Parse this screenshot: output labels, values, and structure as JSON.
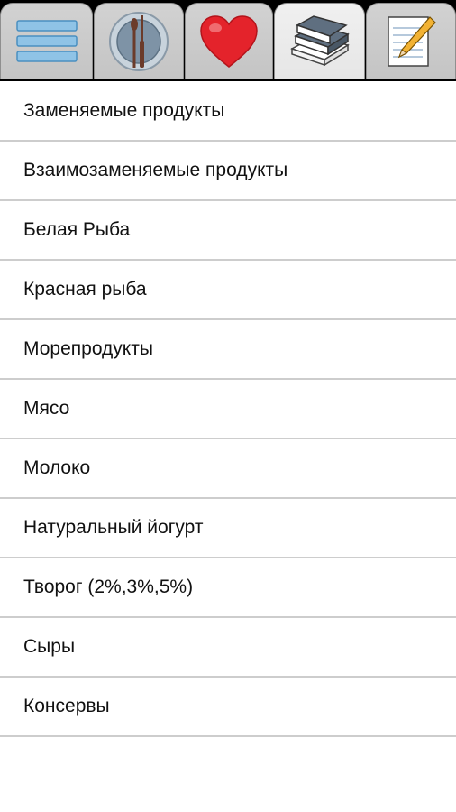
{
  "tabs": [
    {
      "icon": "list-menu-icon",
      "active": false
    },
    {
      "icon": "plate-cutlery-icon",
      "active": false
    },
    {
      "icon": "heart-icon",
      "active": false
    },
    {
      "icon": "books-icon",
      "active": true
    },
    {
      "icon": "notepad-pencil-icon",
      "active": false
    }
  ],
  "list": {
    "items": [
      "Заменяемые продукты",
      "Взаимозаменяемые продукты",
      "Белая Рыба",
      "Красная рыба",
      "Морепродукты",
      "Мясо",
      "Молоко",
      "Натуральный йогурт",
      "Творог (2%,3%,5%)",
      "Сыры",
      "Консервы"
    ]
  },
  "colors": {
    "heart": "#e4232b",
    "tabbar_background": "#000000",
    "divider": "#cdcdcd"
  }
}
